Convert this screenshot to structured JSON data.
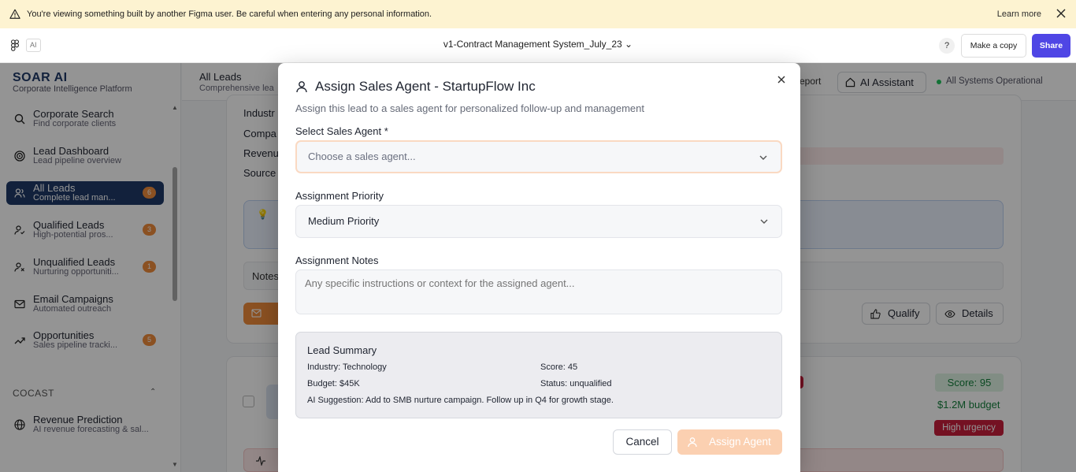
{
  "banner": {
    "message": "You're viewing something built by another Figma user. Be careful when entering any personal information.",
    "learn_more": "Learn more"
  },
  "figma": {
    "ai_chip": "AI",
    "doc_title": "v1-Contract Management System_July_23",
    "help": "?",
    "make_copy": "Make a copy",
    "share": "Share"
  },
  "app": {
    "brand": "SOAR AI",
    "brand_sub": "Corporate Intelligence Platform",
    "nav": [
      {
        "title": "Corporate Search",
        "sub": "Find corporate clients",
        "icon": "search-icon"
      },
      {
        "title": "Lead Dashboard",
        "sub": "Lead pipeline overview",
        "icon": "target-icon"
      },
      {
        "title": "All Leads",
        "sub": "Complete lead man...",
        "count": "6",
        "icon": "users-icon"
      },
      {
        "title": "Qualified Leads",
        "sub": "High-potential pros...",
        "count": "3",
        "icon": "user-check-icon"
      },
      {
        "title": "Unqualified Leads",
        "sub": "Nurturing opportuniti...",
        "count": "1",
        "icon": "user-x-icon"
      },
      {
        "title": "Email Campaigns",
        "sub": "Automated outreach",
        "icon": "mail-icon"
      },
      {
        "title": "Opportunities",
        "sub": "Sales pipeline tracki...",
        "count": "5",
        "icon": "trending-up-icon"
      }
    ],
    "section_cocast": "COCAST",
    "nav_revenue": {
      "title": "Revenue Prediction",
      "sub": "AI revenue forecasting & sal..."
    },
    "header": {
      "title": "All Leads",
      "subtitle": "Comprehensive lead management",
      "report": "eport",
      "ai_assistant": "AI Assistant",
      "status": "All Systems Operational"
    },
    "card_labels": [
      "Industr",
      "Compa",
      "Revenu",
      "Source"
    ],
    "notes_label": "Notes",
    "qualify": "Qualify",
    "details": "Details",
    "score": "Score: 95",
    "budget": "$1.2M budget",
    "urgency": "High urgency"
  },
  "modal": {
    "title": "Assign Sales Agent - StartupFlow Inc",
    "description": "Assign this lead to a sales agent for personalized follow-up and management",
    "agent_label": "Select Sales Agent *",
    "agent_placeholder": "Choose a sales agent...",
    "priority_label": "Assignment Priority",
    "priority_value": "Medium Priority",
    "notes_label": "Assignment Notes",
    "notes_placeholder": "Any specific instructions or context for the assigned agent...",
    "summary": {
      "title": "Lead Summary",
      "industry": "Industry: Technology",
      "score": "Score: 45",
      "budget": "Budget: $45K",
      "status": "Status: unqualified",
      "suggestion": "AI Suggestion: Add to SMB nurture campaign. Follow up in Q4 for growth stage."
    },
    "cancel": "Cancel",
    "assign": "Assign Agent"
  }
}
